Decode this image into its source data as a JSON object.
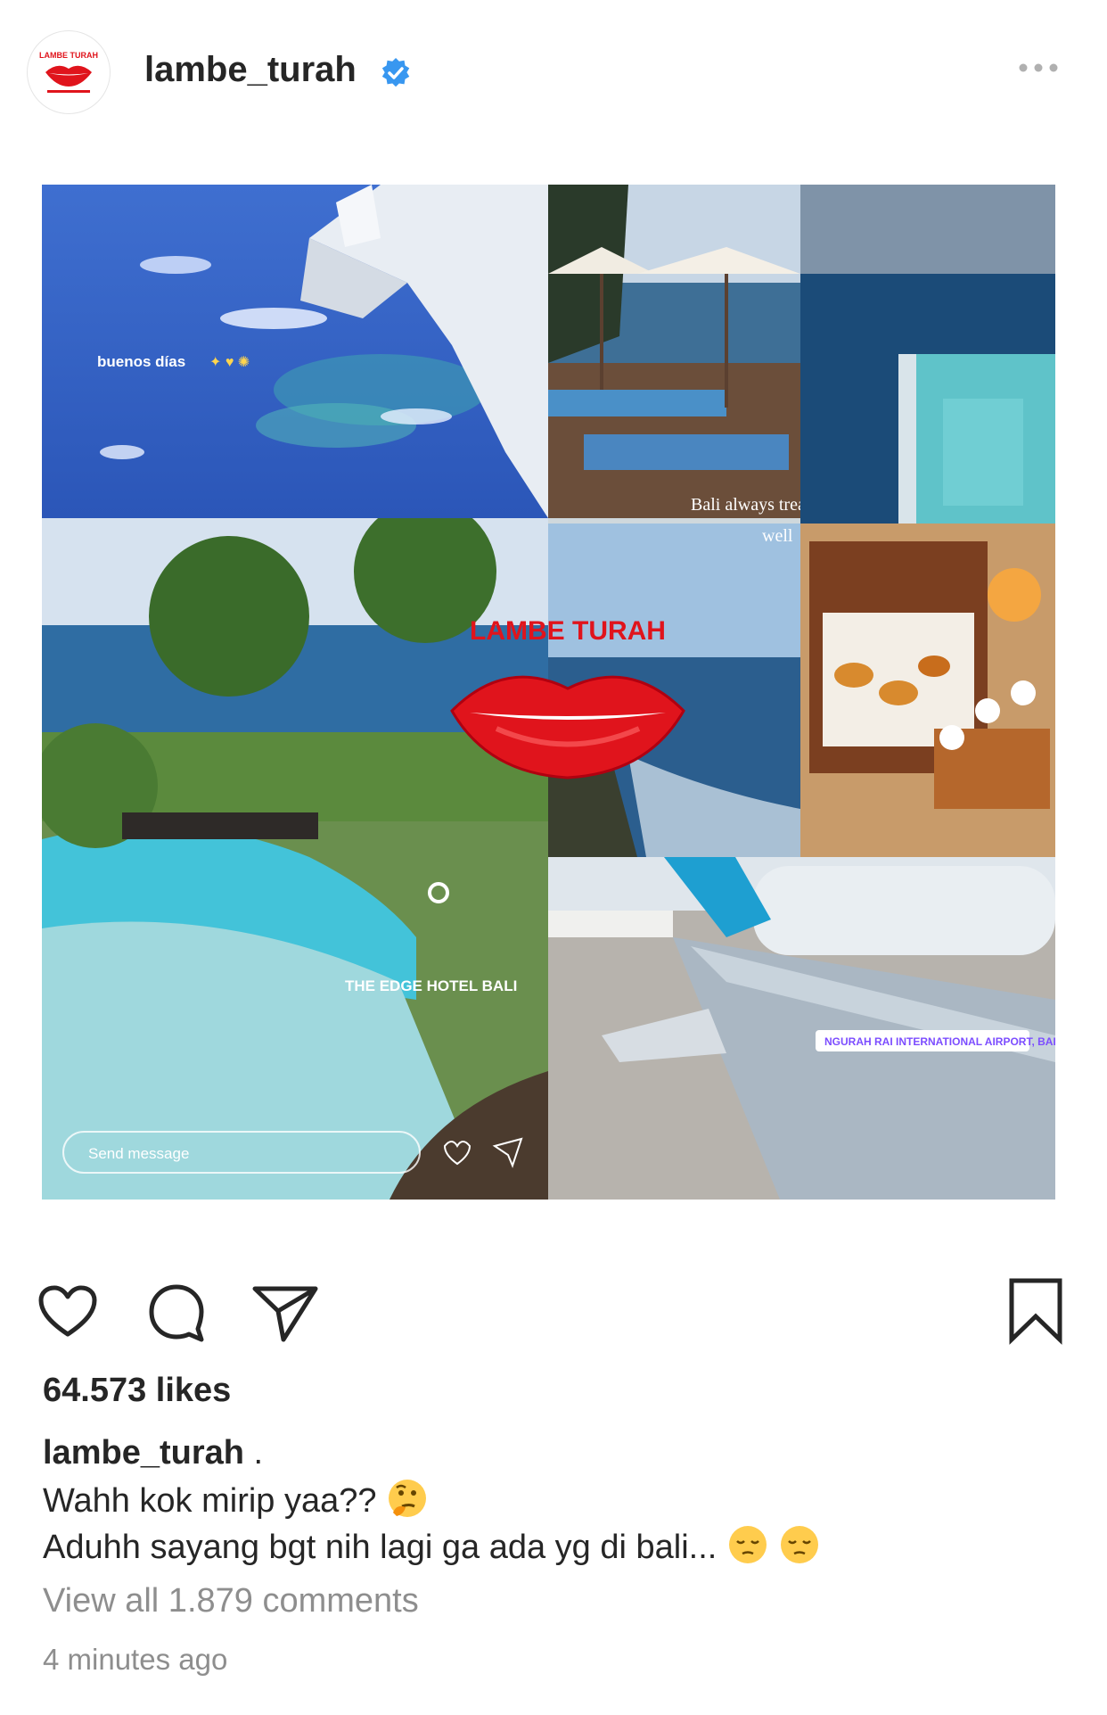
{
  "post": {
    "username": "lambe_turah",
    "avatar_brand": "LAMBE TURAH",
    "more_icon": "more-horizontal-icon",
    "verified_icon": "verified-badge-icon"
  },
  "collage": {
    "story_texts": {
      "greeting": "buenos días",
      "bali_line1": "Bali always treated me",
      "bali_line2": "well",
      "edge_hotel": "THE EDGE HOTEL BALI",
      "airport": "NGURAH RAI INTERNATIONAL AIRPORT, BALI",
      "send_message": "Send message"
    },
    "watermark": "LAMBE TURAH"
  },
  "actions": {
    "like_icon": "heart-icon",
    "comment_icon": "comment-icon",
    "share_icon": "send-icon",
    "save_icon": "bookmark-icon"
  },
  "likes": "64.573 likes",
  "caption": {
    "username": "lambe_turah",
    "username_suffix": " .",
    "line1": "Wahh kok mirip yaa?? ",
    "line2": "Aduhh sayang bgt nih lagi ga ada yg di bali..."
  },
  "view_comments": "View all 1.879 comments",
  "timestamp": "4 minutes ago",
  "colors": {
    "verified_blue": "#3897f0",
    "lip_red": "#e0141c",
    "text": "#262626",
    "muted": "#8e8e8e"
  }
}
